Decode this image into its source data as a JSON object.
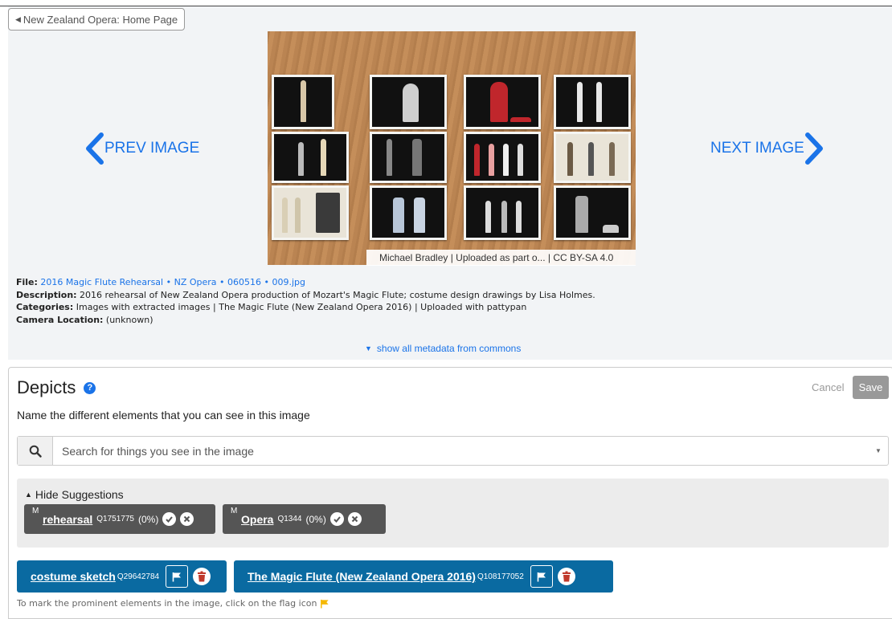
{
  "header": {
    "back_label": "New Zealand Opera: Home Page"
  },
  "viewer": {
    "prev_label": "PREV IMAGE",
    "next_label": "NEXT IMAGE",
    "caption": "Michael Bradley | Uploaded as part o... | CC BY-SA 4.0"
  },
  "metadata": {
    "file_label": "File:",
    "file_value": "2016 Magic Flute Rehearsal • NZ Opera • 060516 • 009.jpg",
    "description_label": "Description:",
    "description_value": "2016 rehearsal of New Zealand Opera production of Mozart's Magic Flute; costume design drawings by Lisa Holmes.",
    "categories_label": "Categories:",
    "categories_value": "Images with extracted images | The Magic Flute (New Zealand Opera 2016) | Uploaded with pattypan",
    "camera_label": "Camera Location:",
    "camera_value": "(unknown)",
    "show_all": "show all metadata from commons"
  },
  "depicts": {
    "title": "Depicts",
    "help": "?",
    "cancel": "Cancel",
    "save": "Save",
    "instruction": "Name the different elements that you can see in this image",
    "search_placeholder": "Search for things you see in the image",
    "hide_suggestions": "Hide Suggestions",
    "suggestions": [
      {
        "marker": "M",
        "label": "rehearsal",
        "qid": "Q1751775",
        "pct": "(0%)"
      },
      {
        "marker": "M",
        "label": "Opera",
        "qid": "Q1344",
        "pct": "(0%)"
      }
    ],
    "tags": [
      {
        "label": "costume sketch",
        "qid": "Q29642784"
      },
      {
        "label": "The Magic Flute (New Zealand Opera 2016)",
        "qid": "Q108177052"
      }
    ],
    "hint": "To mark the prominent elements in the image, click on the flag icon"
  },
  "colors": {
    "accent": "#1a73e8",
    "tag_bg": "#0a6aa1",
    "suggestion_bg": "#555555",
    "delete_red": "#c0392b",
    "flag_yellow": "#f5b800"
  }
}
